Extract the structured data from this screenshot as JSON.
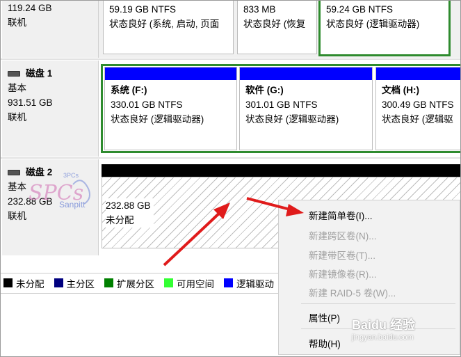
{
  "top_row": {
    "disk_size": "119.24 GB",
    "disk_status": "联机",
    "volumes": [
      {
        "size": "59.19 GB NTFS",
        "status": "状态良好 (系统, 启动, 页面"
      },
      {
        "size": "833 MB",
        "status": "状态良好 (恢复"
      },
      {
        "size": "59.24 GB NTFS",
        "status": "状态良好 (逻辑驱动器)"
      }
    ]
  },
  "disk1": {
    "name": "磁盘 1",
    "type": "基本",
    "size": "931.51 GB",
    "status": "联机",
    "volumes": [
      {
        "title": "系统 (F:)",
        "size": "330.01 GB NTFS",
        "status": "状态良好 (逻辑驱动器)"
      },
      {
        "title": "软件 (G:)",
        "size": "301.01 GB NTFS",
        "status": "状态良好 (逻辑驱动器)"
      },
      {
        "title": "文档 (H:)",
        "size": "300.49 GB NTFS",
        "status": "状态良好 (逻辑驱"
      }
    ]
  },
  "disk2": {
    "name": "磁盘 2",
    "type": "基本",
    "size": "232.88 GB",
    "status": "联机",
    "unallocated_size": "232.88 GB",
    "unallocated_label": "未分配"
  },
  "legend": [
    {
      "label": "未分配",
      "color": "#000000"
    },
    {
      "label": "主分区",
      "color": "#00007f"
    },
    {
      "label": "扩展分区",
      "color": "#008000"
    },
    {
      "label": "可用空间",
      "color": "#33ff33"
    },
    {
      "label": "逻辑驱动",
      "color": "#0000ff"
    }
  ],
  "context_menu": {
    "new_simple": "新建简单卷(I)...",
    "new_spanned": "新建跨区卷(N)...",
    "new_striped": "新建带区卷(T)...",
    "new_mirrored": "新建镜像卷(R)...",
    "new_raid5": "新建 RAID-5 卷(W)...",
    "properties": "属性(P)",
    "help": "帮助(H)"
  },
  "watermarks": {
    "sanpitt": "Sanpitt",
    "spcs": "3PCs",
    "baidu": "Baidu 经验",
    "baidu_url": "jingyan.baidu.com"
  },
  "accent_colors": {
    "arrow": "#e01b1b",
    "volume_bar": "#0000ff",
    "selection_border": "#2e8b2e"
  }
}
